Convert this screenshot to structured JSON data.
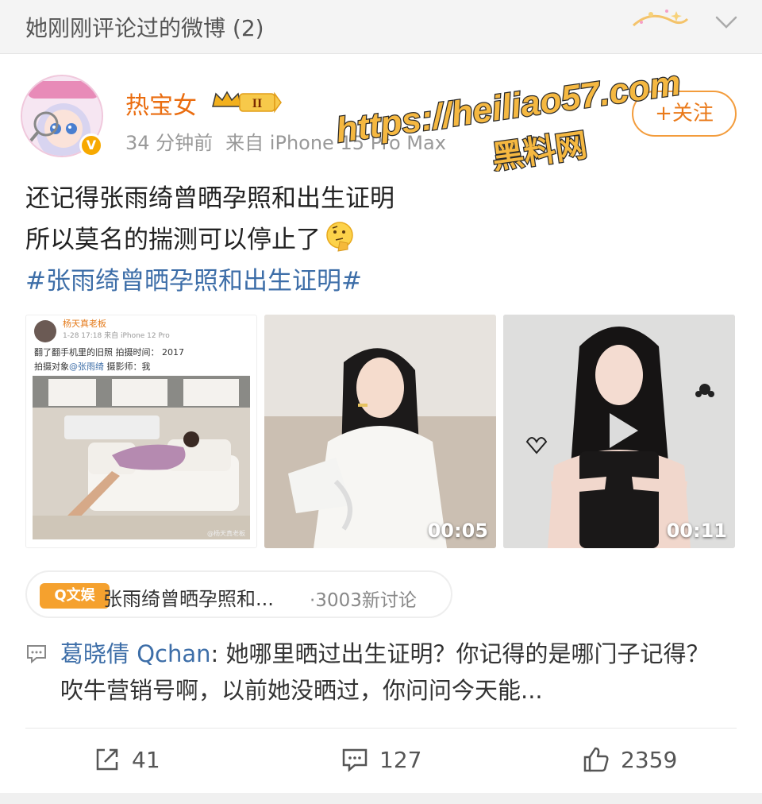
{
  "section": {
    "title": "她刚刚评论过的微博 (2)"
  },
  "post": {
    "author": "热宝女",
    "level_badge": "II",
    "time": "34 分钟前",
    "source": "来自 iPhone 15 Pro Max",
    "follow_label": "+关注",
    "text_lines": [
      "还记得张雨绮曾晒孕照和出生证明",
      "所以莫名的揣测可以停止了"
    ],
    "hashtag": "#张雨绮曾晒孕照和出生证明#"
  },
  "watermark": {
    "url": "https://heiliao57.com",
    "name": "黑料网"
  },
  "media": {
    "screenshot": {
      "name": "杨天真老板",
      "meta": "1-28 17:18  来自 iPhone 12 Pro",
      "line1": "翻了翻手机里的旧照 拍摄时间：  2017",
      "line2_prefix": "拍摄对象",
      "line2_mention": "@张雨绮",
      "line2_suffix": " 摄影师：我",
      "credit": "@杨天真老板"
    },
    "video1_duration": "00:05",
    "video2_duration": "00:11"
  },
  "topic": {
    "tag": "Q文娱",
    "title": "张雨绮曾晒孕照和...",
    "count": "·3003新讨论"
  },
  "comment": {
    "author": "葛晓倩 Qchan",
    "text": ": 她哪里晒过出生证明？你记得的是哪门子记得？吹牛营销号啊，以前她没晒过，你问问今天能..."
  },
  "actions": {
    "reposts": "41",
    "comments": "127",
    "likes": "2359"
  },
  "colors": {
    "username": "#ea6d10",
    "link": "#3d6ea8",
    "follow": "#f39c3c",
    "topic_tag": "#f5a12e",
    "watermark_fill": "#f5b841"
  }
}
